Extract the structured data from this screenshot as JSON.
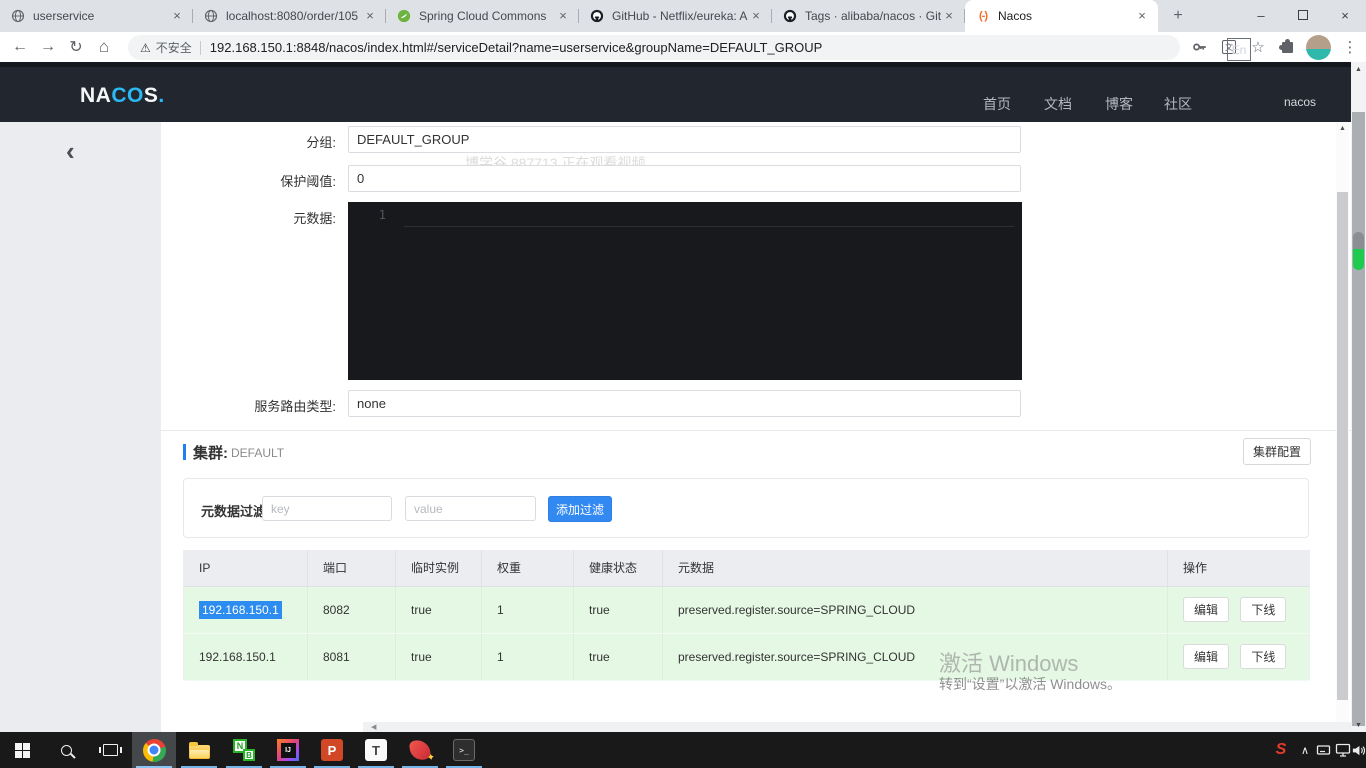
{
  "colors": {
    "accent_blue": "#3389f2",
    "row_green": "#e5f8e4",
    "selection_blue": "#2d8cf0",
    "nacos_header_bg": "#22272f",
    "logo_blue": "#2bb8f4",
    "taskbar_underline": "#76b5e8"
  },
  "browser": {
    "tabs": [
      {
        "title": "userservice"
      },
      {
        "title": "localhost:8080/order/105"
      },
      {
        "title": "Spring Cloud Commons"
      },
      {
        "title": "GitHub - Netflix/eureka: A"
      },
      {
        "title": "Tags · alibaba/nacos · GitH"
      },
      {
        "title": "Nacos"
      }
    ],
    "tab_close_glyph": "×",
    "new_tab_glyph": "+",
    "window_controls": {
      "minimize": "–",
      "close": "×"
    },
    "toolbar": {
      "back": "←",
      "forward": "→",
      "reload": "↻",
      "home": "⌂",
      "warning_glyph": "⚠",
      "security_label": "不安全",
      "url": "192.168.150.1:8848/nacos/index.html#/serviceDetail?name=userservice&groupName=DEFAULT_GROUP",
      "star": "☆",
      "translate_glyph": "文",
      "menu": "⋮"
    }
  },
  "nacos": {
    "logo_na": "NA",
    "logo_co": "CO",
    "logo_s": "S",
    "logo_dot": ".",
    "nav": [
      {
        "label": "首页"
      },
      {
        "label": "文档"
      },
      {
        "label": "博客"
      },
      {
        "label": "社区"
      }
    ],
    "lang_toggle": "En",
    "username": "nacos",
    "collapse_glyph": "‹"
  },
  "watermarks": {
    "viewer": "博学谷 887713 正在观看视频",
    "win_line1": "激活 Windows",
    "win_line2": "转到“设置”以激活 Windows。"
  },
  "form": {
    "group_label": "分组:",
    "group_value": "DEFAULT_GROUP",
    "threshold_label": "保护阈值:",
    "threshold_value": "0",
    "metadata_label": "元数据:",
    "metadata_line_number": "1",
    "route_label": "服务路由类型:",
    "route_value": "none"
  },
  "cluster": {
    "title": "集群:",
    "name": "DEFAULT",
    "config_button": "集群配置",
    "filter": {
      "label": "元数据过滤",
      "key_placeholder": "key",
      "value_placeholder": "value",
      "add_button": "添加过滤"
    }
  },
  "table": {
    "headers": [
      "IP",
      "端口",
      "临时实例",
      "权重",
      "健康状态",
      "元数据",
      "操作"
    ],
    "rows": [
      {
        "ip": "192.168.150.1",
        "port": "8082",
        "ephemeral": "true",
        "weight": "1",
        "healthy": "true",
        "metadata": "preserved.register.source=SPRING_CLOUD"
      },
      {
        "ip": "192.168.150.1",
        "port": "8081",
        "ephemeral": "true",
        "weight": "1",
        "healthy": "true",
        "metadata": "preserved.register.source=SPRING_CLOUD"
      }
    ],
    "edit_button": "编辑",
    "offline_button": "下线"
  },
  "taskbar": {
    "glyphs": {
      "notepad_n": "N",
      "notepad_b": "B",
      "intellij": "IJ",
      "powerpoint": "P",
      "typora": "T",
      "terminal": ">_",
      "sogou": "S",
      "chevron_up": "∧"
    }
  },
  "scroll": {
    "up": "▲",
    "down": "▼",
    "left": "◀"
  }
}
